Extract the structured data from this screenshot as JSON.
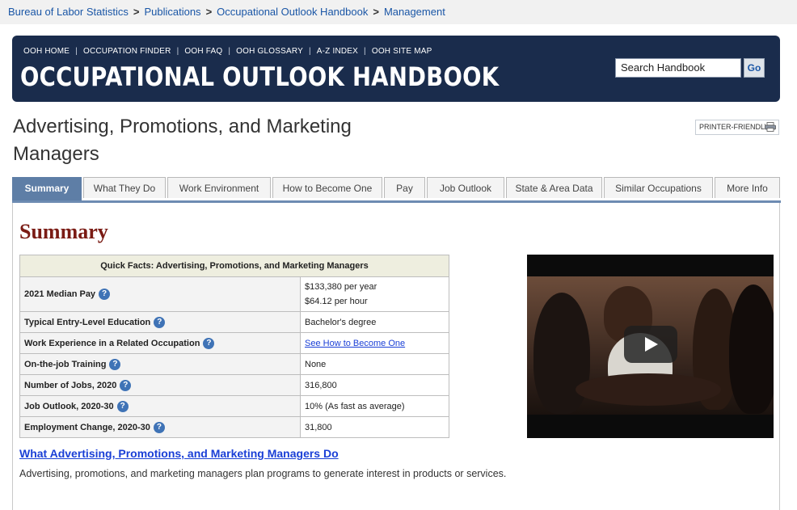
{
  "breadcrumb": [
    "Bureau of Labor Statistics",
    "Publications",
    "Occupational Outlook Handbook",
    "Management"
  ],
  "banner": {
    "nav": [
      "OOH HOME",
      "OCCUPATION FINDER",
      "OOH FAQ",
      "OOH GLOSSARY",
      "A-Z INDEX",
      "OOH SITE MAP"
    ],
    "title": "OCCUPATIONAL OUTLOOK HANDBOOK",
    "search_value": "Search Handbook",
    "go_label": "Go"
  },
  "page_title_line1": "Advertising, Promotions, and Marketing",
  "page_title_line2": "Managers",
  "printer_label": "PRINTER-FRIENDLY",
  "tabs": [
    "Summary",
    "What They Do",
    "Work Environment",
    "How to Become One",
    "Pay",
    "Job Outlook",
    "State & Area Data",
    "Similar Occupations",
    "More Info"
  ],
  "summary_heading": "Summary",
  "quick_facts": {
    "header": "Quick Facts: Advertising, Promotions, and Marketing Managers",
    "rows": [
      {
        "label": "2021 Median Pay",
        "value": "$133,380 per year",
        "value2": "$64.12 per hour"
      },
      {
        "label": "Typical Entry-Level Education",
        "value": "Bachelor's degree"
      },
      {
        "label": "Work Experience in a Related Occupation",
        "value": "See How to Become One"
      },
      {
        "label": "On-the-job Training",
        "value": "None"
      },
      {
        "label": "Number of Jobs, 2020",
        "value": "316,800"
      },
      {
        "label": "Job Outlook, 2020-30",
        "value": "10% (As fast as average)"
      },
      {
        "label": "Employment Change, 2020-30",
        "value": "31,800"
      }
    ],
    "help_glyph": "?"
  },
  "what_they_do_link": "What Advertising, Promotions, and Marketing Managers Do",
  "what_they_do_text": "Advertising, promotions, and marketing managers plan programs to generate interest in products or services."
}
